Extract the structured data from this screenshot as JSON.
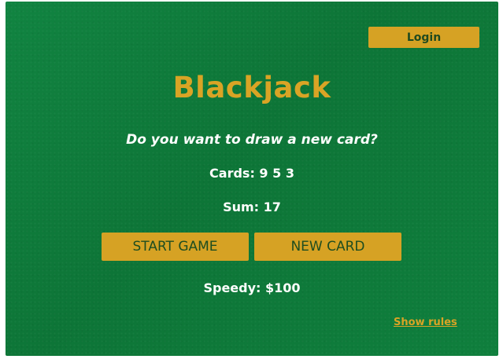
{
  "header": {
    "login_label": "Login"
  },
  "game": {
    "title": "Blackjack",
    "message": "Do you want to draw a new card?",
    "cards_text": "Cards: 9 5 3",
    "sum_text": "Sum: 17",
    "player_text": "Speedy: $100"
  },
  "controls": {
    "start_label": "START GAME",
    "new_card_label": "NEW CARD"
  },
  "footer": {
    "rules_link": "Show rules"
  },
  "colors": {
    "felt": "#0f7c3b",
    "accent_gold": "#d6a224",
    "button_text": "#1e4d20",
    "text": "#ffffff"
  }
}
